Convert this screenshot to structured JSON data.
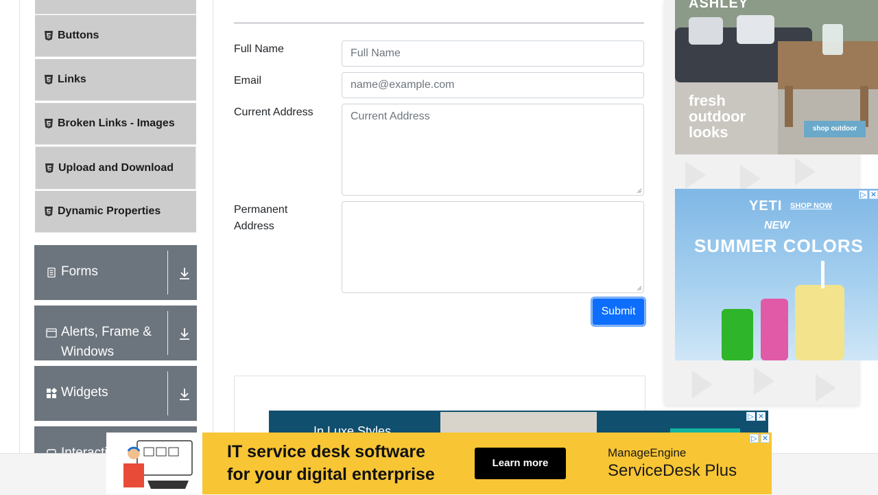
{
  "sidebar": {
    "elements_items": [
      {
        "label": "Buttons"
      },
      {
        "label": "Links"
      },
      {
        "label": "Broken Links - Images"
      },
      {
        "label": "Upload and Download"
      },
      {
        "label": "Dynamic Properties"
      }
    ],
    "groups": [
      {
        "label": "Forms",
        "icon": "document-icon"
      },
      {
        "label_line1": "Alerts, Frame &",
        "label_line2": "Windows",
        "icon": "window-icon"
      },
      {
        "label": "Widgets",
        "icon": "widgets-icon"
      },
      {
        "label": "Interacti",
        "icon": "interactions-icon"
      }
    ]
  },
  "form": {
    "full_name_label": "Full Name",
    "full_name_placeholder": "Full Name",
    "email_label": "Email",
    "email_placeholder": "name@example.com",
    "current_address_label": "Current Address",
    "current_address_placeholder": "Current Address",
    "permanent_address_label_line1": "Permanent",
    "permanent_address_label_line2": "Address",
    "submit_label": "Submit"
  },
  "ads": {
    "ashley": {
      "brand": "ASHLEY",
      "headline_1": "fresh",
      "headline_2": "outdoor",
      "headline_3": "looks",
      "cta": "shop outdoor"
    },
    "yeti": {
      "brand": "YETI",
      "cta": "SHOP NOW",
      "line_1": "NEW",
      "line_2": "SUMMER COLORS"
    },
    "mid_banner": {
      "text": "In Luxe Styles"
    },
    "servicedesk": {
      "headline_1": "IT service desk software",
      "headline_2": "for your digital enterprise",
      "cta": "Learn more",
      "brand_1": "ManageEngine",
      "brand_2": "ServiceDesk Plus"
    },
    "close_glyph": "✕"
  },
  "colors": {
    "sidebar_item_bg": "#cccccc",
    "sidebar_group_bg": "#6c757d",
    "submit_bg": "#0d6efd",
    "ad_yellow": "#f8c534"
  }
}
